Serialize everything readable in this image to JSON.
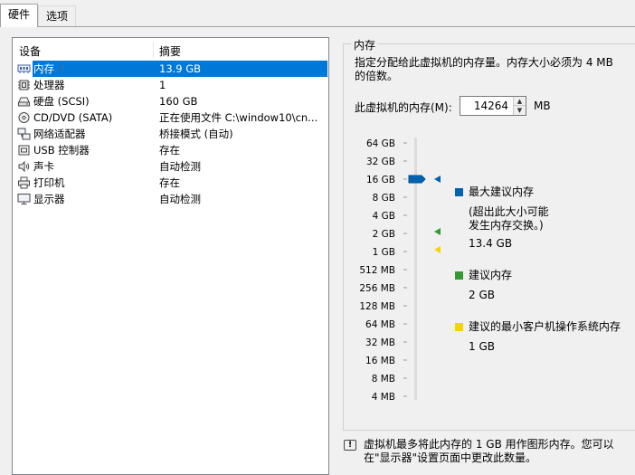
{
  "tabs": [
    {
      "label": "硬件",
      "active": true
    },
    {
      "label": "选项",
      "active": false
    }
  ],
  "device_list": {
    "headers": {
      "device": "设备",
      "summary": "摘要"
    },
    "items": [
      {
        "name": "内存",
        "summary": "13.9 GB",
        "icon": "memory-icon",
        "selected": true
      },
      {
        "name": "处理器",
        "summary": "1",
        "icon": "processor-icon",
        "selected": false
      },
      {
        "name": "硬盘 (SCSI)",
        "summary": "160 GB",
        "icon": "hard-disk-icon",
        "selected": false
      },
      {
        "name": "CD/DVD (SATA)",
        "summary": "正在使用文件 C:\\window10\\cn...",
        "icon": "cd-dvd-icon",
        "selected": false
      },
      {
        "name": "网络适配器",
        "summary": "桥接模式 (自动)",
        "icon": "network-adapter-icon",
        "selected": false
      },
      {
        "name": "USB 控制器",
        "summary": "存在",
        "icon": "usb-controller-icon",
        "selected": false
      },
      {
        "name": "声卡",
        "summary": "自动检测",
        "icon": "sound-card-icon",
        "selected": false
      },
      {
        "name": "打印机",
        "summary": "存在",
        "icon": "printer-icon",
        "selected": false
      },
      {
        "name": "显示器",
        "summary": "自动检测",
        "icon": "display-icon",
        "selected": false
      }
    ]
  },
  "memory": {
    "group_title": "内存",
    "description": "指定分配给此虚拟机的内存量。内存大小必须为 4 MB 的倍数。",
    "field_label": "此虚拟机的内存(M):",
    "value": "14264",
    "unit": "MB",
    "scale_labels": [
      "64 GB",
      "32 GB",
      "16 GB",
      "8 GB",
      "4 GB",
      "2 GB",
      "1 GB",
      "512 MB",
      "256 MB",
      "128 MB",
      "64 MB",
      "32 MB",
      "16 MB",
      "8 MB",
      "4 MB"
    ],
    "current_marker": "16 GB",
    "legend": {
      "max": {
        "title": "最大建议内存",
        "note_line1": "(超出此大小可能",
        "note_line2": "发生内存交换。)",
        "value": "13.4 GB",
        "color": "#0063b1"
      },
      "recommended": {
        "title": "建议内存",
        "value": "2 GB",
        "color": "#339933"
      },
      "min_guest": {
        "title": "建议的最小客户机操作系统内存",
        "value": "1 GB",
        "color": "#f2d600"
      }
    },
    "info_text": "虚拟机最多将此内存的 1 GB 用作图形内存。您可以在\"显示器\"设置页面中更改此数量。"
  }
}
